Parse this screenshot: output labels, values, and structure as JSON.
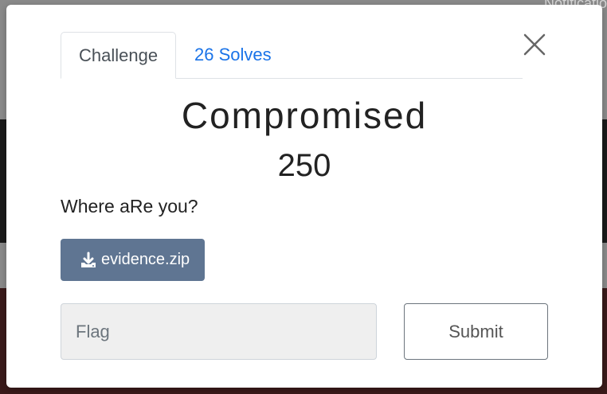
{
  "background": {
    "notification_text": "Notificatio"
  },
  "modal": {
    "tabs": [
      {
        "label": "Challenge",
        "active": true
      },
      {
        "label": "26 Solves",
        "active": false
      }
    ],
    "challenge": {
      "name": "Compromised",
      "value": "250",
      "description": "Where aRe you?"
    },
    "file": {
      "label": "evidence.zip",
      "icon": "download-icon"
    },
    "flag_input": {
      "placeholder": "Flag",
      "value": ""
    },
    "submit_label": "Submit",
    "close_icon": "close-icon"
  },
  "colors": {
    "tab_link": "#1a73e8",
    "file_button_bg": "#5f7592",
    "input_bg": "#efefef"
  }
}
